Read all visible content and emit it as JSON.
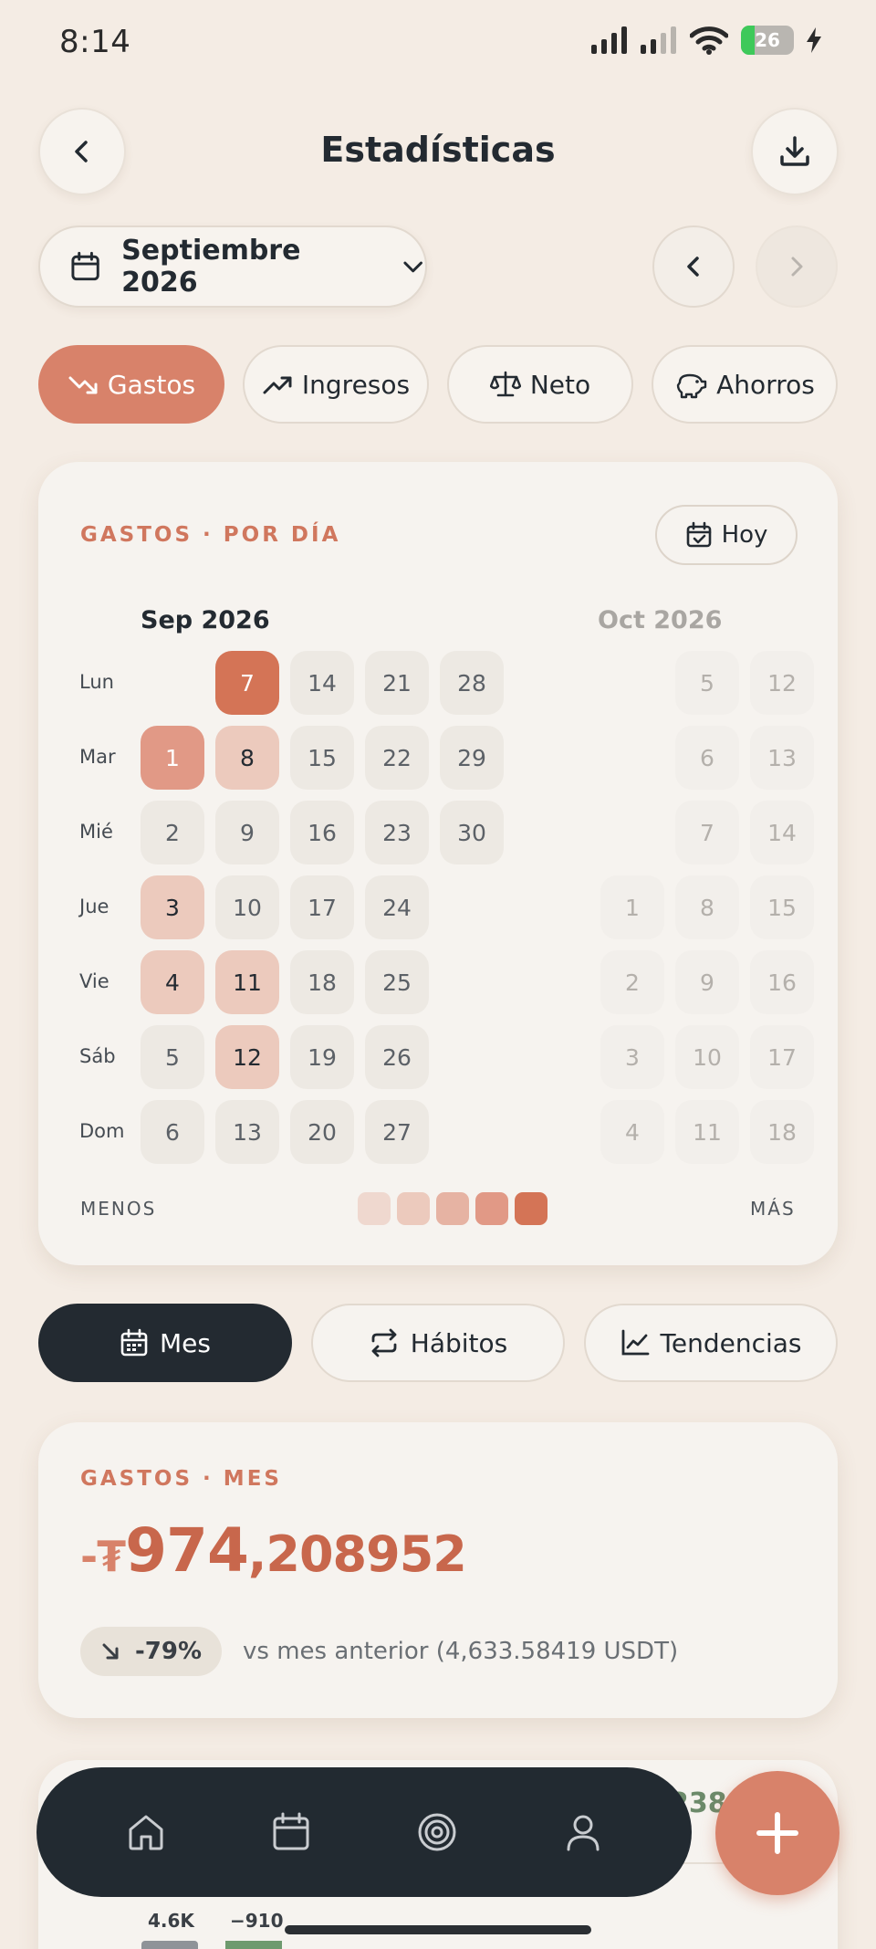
{
  "status_bar": {
    "time": "8:14",
    "battery": "26",
    "battery_level": 0.26
  },
  "header": {
    "title": "Estadísticas"
  },
  "month_selector": {
    "label": "Septiembre 2026"
  },
  "filters": [
    {
      "label": "Gastos",
      "icon": "trending-down-icon",
      "active": true
    },
    {
      "label": "Ingresos",
      "icon": "trending-up-icon",
      "active": false
    },
    {
      "label": "Neto",
      "icon": "scale-icon",
      "active": false
    },
    {
      "label": "Ahorros",
      "icon": "piggy-bank-icon",
      "active": false
    }
  ],
  "heatmap": {
    "section_label": "GASTOS · POR DÍA",
    "today_button": "Hoy",
    "weekdays": [
      "Lun",
      "Mar",
      "Mié",
      "Jue",
      "Vie",
      "Sáb",
      "Dom"
    ],
    "months": [
      {
        "name": "Sep 2026",
        "weeks": [
          [
            null,
            1,
            2,
            3,
            4,
            5,
            6
          ],
          [
            7,
            8,
            9,
            10,
            11,
            12,
            13
          ],
          [
            14,
            15,
            16,
            17,
            18,
            19,
            20
          ],
          [
            21,
            22,
            23,
            24,
            25,
            26,
            27
          ],
          [
            28,
            29,
            30,
            null,
            null,
            null,
            null
          ]
        ],
        "intensity": {
          "1": 4,
          "3": 2,
          "4": 2,
          "7": 5,
          "8": 2,
          "11": 2,
          "12": 2
        }
      },
      {
        "name": "Oct 2026",
        "weeks": [
          [
            null,
            null,
            null,
            1,
            2,
            3,
            4
          ],
          [
            5,
            6,
            7,
            8,
            9,
            10,
            11
          ],
          [
            12,
            13,
            14,
            15,
            16,
            17,
            18
          ]
        ]
      }
    ],
    "legend": {
      "less": "MENOS",
      "more": "MÁS",
      "colors": [
        "#efd8cf",
        "#eccabd",
        "#e6b3a3",
        "#e19986",
        "#d47456"
      ]
    }
  },
  "view_tabs": [
    {
      "label": "Mes",
      "icon": "calendar-icon",
      "active": true
    },
    {
      "label": "Hábitos",
      "icon": "repeat-icon",
      "active": false
    },
    {
      "label": "Tendencias",
      "icon": "line-chart-icon",
      "active": false
    }
  ],
  "summary": {
    "section_label": "GASTOS · MES",
    "amount_sign": "-",
    "amount_symbol": "₮",
    "amount_int": "974",
    "amount_dec": ",208952",
    "delta": "-79%",
    "comparison": "vs mes anterior (4,633.58419 USDT)"
  },
  "next_card_peek": {
    "value": "238",
    "bar_labels": [
      "4.6K",
      "−910"
    ]
  },
  "bottom_nav": [
    {
      "icon": "home-icon"
    },
    {
      "icon": "calendar-icon"
    },
    {
      "icon": "target-icon"
    },
    {
      "icon": "user-icon"
    }
  ],
  "colors": {
    "accent": "#d8826a",
    "dark": "#232a31",
    "background": "#f4ece4"
  }
}
